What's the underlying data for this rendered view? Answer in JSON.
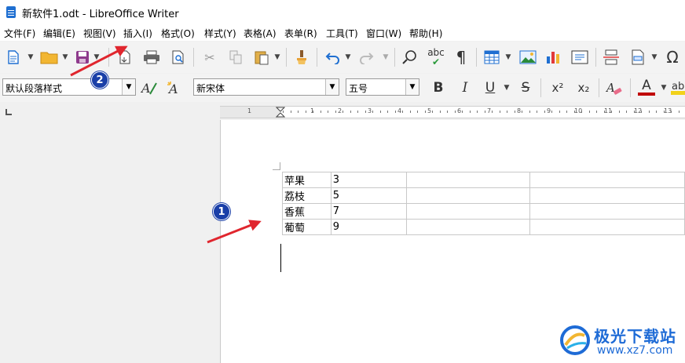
{
  "window": {
    "title": "新软件1.odt - LibreOffice Writer"
  },
  "menu": [
    "文件(F)",
    "编辑(E)",
    "视图(V)",
    "插入(I)",
    "格式(O)",
    "样式(Y)",
    "表格(A)",
    "表单(R)",
    "工具(T)",
    "窗口(W)",
    "帮助(H)"
  ],
  "formatting": {
    "paragraph_style": "默认段落样式",
    "font_name": "新宋体",
    "font_size": "五号",
    "bold_label": "B",
    "italic_label": "I",
    "underline_label": "U",
    "strike_label": "S",
    "superscript_label": "x²",
    "subscript_label": "x₂",
    "font_color_label": "A",
    "font_color": "#c00000"
  },
  "toolbar": {
    "spellcheck_label": "abc",
    "special_char_label": "Ω",
    "pilcrow": "¶"
  },
  "ruler": {
    "labels": [
      "1",
      "1",
      "2",
      "3",
      "4",
      "5",
      "6",
      "7",
      "8",
      "9",
      "10",
      "11",
      "12",
      "13"
    ]
  },
  "table": {
    "rows": [
      {
        "name": "苹果",
        "value": "3"
      },
      {
        "name": "荔枝",
        "value": "5"
      },
      {
        "name": "香蕉",
        "value": "7"
      },
      {
        "name": "葡萄",
        "value": "9"
      }
    ]
  },
  "callouts": {
    "first": "1",
    "second": "2"
  },
  "watermark": {
    "text": "极光下载站",
    "url": "www.xz7.com"
  },
  "colors": {
    "accent": "#1a3fa8",
    "annotation_arrow": "#e0262e"
  }
}
